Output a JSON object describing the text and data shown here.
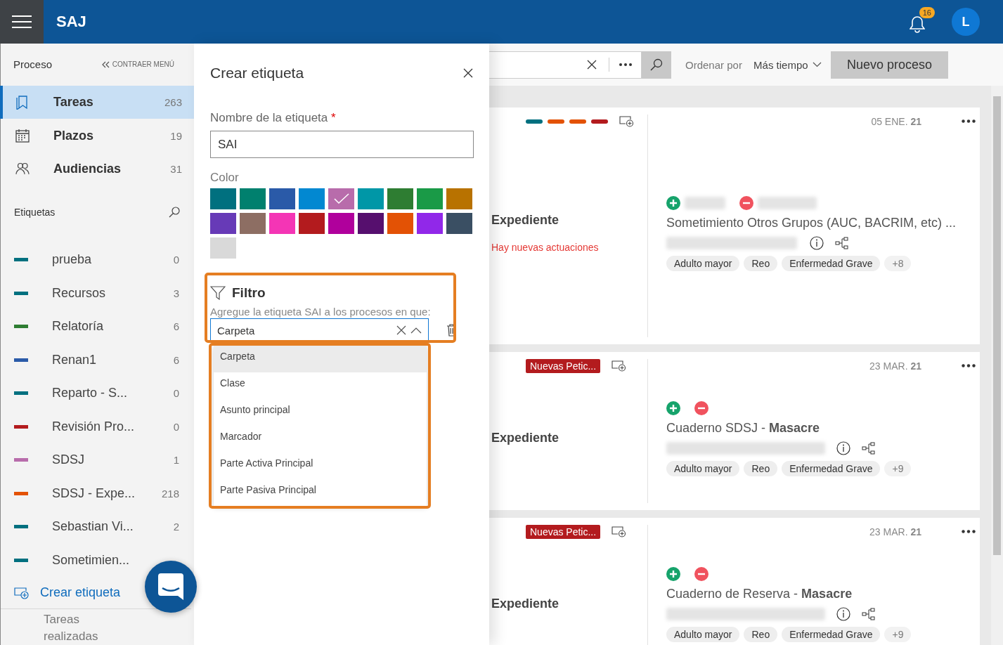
{
  "header": {
    "title": "SAJ",
    "notifications": "16",
    "avatar": "L"
  },
  "sidebar": {
    "section": "Proceso",
    "collapse": "CONTRAER MENÚ",
    "nav": [
      {
        "label": "Tareas",
        "count": "263",
        "selected": true
      },
      {
        "label": "Plazos",
        "count": "19",
        "selected": false
      },
      {
        "label": "Audiencias",
        "count": "31",
        "selected": false
      }
    ],
    "labels_title": "Etiquetas",
    "labels": [
      {
        "name": "prueba",
        "count": "0",
        "color": "#00707f"
      },
      {
        "name": "Recursos",
        "count": "3",
        "color": "#00707f"
      },
      {
        "name": "Relatoría",
        "count": "6",
        "color": "#2e7d32"
      },
      {
        "name": "Renan1",
        "count": "6",
        "color": "#2a5aa8"
      },
      {
        "name": "Reparto - S...",
        "count": "0",
        "color": "#00707f"
      },
      {
        "name": "Revisión Pro...",
        "count": "0",
        "color": "#b31b1e"
      },
      {
        "name": "SDSJ",
        "count": "1",
        "color": "#b86cab"
      },
      {
        "name": "SDSJ - Expe...",
        "count": "218",
        "color": "#e35205"
      },
      {
        "name": "Sebastian Vi...",
        "count": "2",
        "color": "#00707f"
      },
      {
        "name": "Sometimien...",
        "color": "#00707f"
      }
    ],
    "create_label": "Crear etiqueta",
    "footer": "Tareas realizadas"
  },
  "dialog": {
    "title": "Crear etiqueta",
    "name_label": "Nombre de la etiqueta",
    "required_mark": "*",
    "name_value": "SAI",
    "color_label": "Color",
    "swatches": [
      {
        "color": "#00707f",
        "selected": false
      },
      {
        "color": "#00806e",
        "selected": false
      },
      {
        "color": "#2a5aa8",
        "selected": false
      },
      {
        "color": "#0288d1",
        "selected": false
      },
      {
        "color": "#b86cab",
        "selected": true
      },
      {
        "color": "#0097a7",
        "selected": false
      },
      {
        "color": "#2e7d32",
        "selected": false
      },
      {
        "color": "#1a9a47",
        "selected": false
      },
      {
        "color": "#b87200",
        "selected": false
      },
      {
        "color": "#673ab7",
        "selected": false
      },
      {
        "color": "#8d6e63",
        "selected": false
      },
      {
        "color": "#f435b5",
        "selected": false
      },
      {
        "color": "#b31b1e",
        "selected": false
      },
      {
        "color": "#b0009c",
        "selected": false
      },
      {
        "color": "#560f6e",
        "selected": false
      },
      {
        "color": "#e35205",
        "selected": false
      },
      {
        "color": "#9128e9",
        "selected": false
      },
      {
        "color": "#3a4f63",
        "selected": false
      },
      {
        "color": "#d9d9d9",
        "selected": false
      }
    ],
    "filter": {
      "title": "Filtro",
      "hint": "Agregue la etiqueta SAI a los procesos en que:",
      "value": "Carpeta",
      "highlighted": true,
      "options": [
        {
          "label": "Carpeta",
          "selected": true
        },
        {
          "label": "Clase",
          "selected": false
        },
        {
          "label": "Asunto principal",
          "selected": false
        },
        {
          "label": "Marcador",
          "selected": false
        },
        {
          "label": "Parte Activa Principal",
          "selected": false
        },
        {
          "label": "Parte Pasiva Principal",
          "selected": false
        }
      ]
    }
  },
  "toolbar": {
    "sort_label": "Ordenar por",
    "sort_value": "Más tiempo",
    "new_button": "Nuevo proceso"
  },
  "cards": [
    {
      "labels": [
        {
          "color": "#00707f"
        },
        {
          "color": "#e35205"
        },
        {
          "color": "#e35205"
        },
        {
          "color": "#b31b1e"
        }
      ],
      "case_type": "Expediente",
      "alert": "Hay nuevas actuaciones",
      "date": "05 ENE. **21**",
      "names_redacted": true,
      "title": "Sometimiento Otros Grupos (AUC, BACRIM, etc) ...",
      "chips": [
        "Adulto mayor",
        "Reo",
        "Enfermedad Grave"
      ],
      "more": "+8"
    },
    {
      "badge": "Nuevas Petic...",
      "case_type": "Expediente",
      "date": "23 MAR. **21**",
      "names_redacted": false,
      "title": "Cuaderno SDSJ - **Masacre**",
      "chips": [
        "Adulto mayor",
        "Reo",
        "Enfermedad Grave"
      ],
      "more": "+9"
    },
    {
      "badge": "Nuevas Petic...",
      "case_type": "Expediente",
      "date": "23 MAR. **21**",
      "names_redacted": false,
      "title": "Cuaderno de Reserva - **Masacre**",
      "chips": [
        "Adulto mayor",
        "Reo",
        "Enfermedad Grave"
      ],
      "more": "+9"
    }
  ]
}
